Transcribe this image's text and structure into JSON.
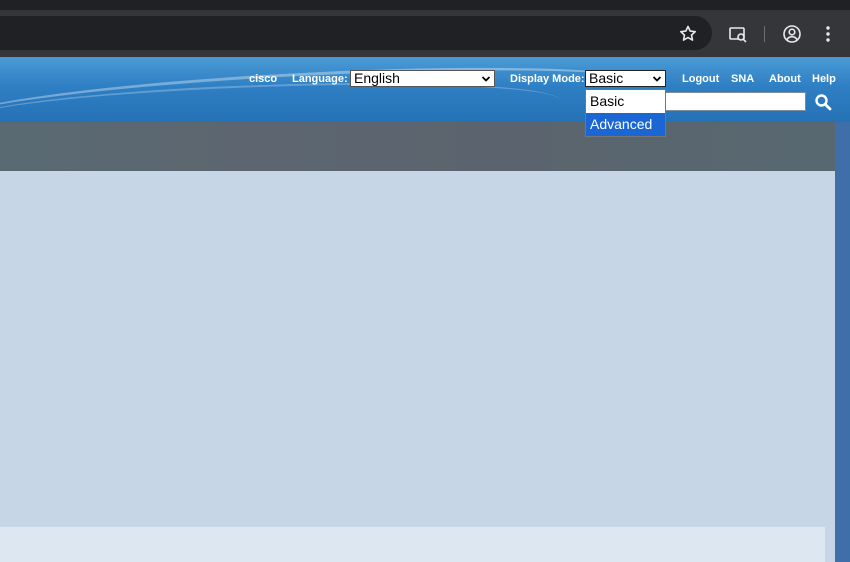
{
  "header": {
    "brand": "cisco",
    "language_label": "Language:",
    "language_value": "English",
    "display_mode_label": "Display Mode:",
    "display_mode_value": "Basic",
    "links": {
      "logout": "Logout",
      "sna": "SNA",
      "about": "About",
      "help": "Help"
    }
  },
  "display_mode_dropdown": {
    "options": [
      "Basic",
      "Advanced"
    ],
    "highlighted": "Advanced"
  },
  "icons": {
    "bookmark": "star-icon",
    "search_tabs": "tab-search-icon",
    "profile": "profile-icon",
    "menu": "kebab-menu-icon",
    "search": "search-icon",
    "chevron": "chevron-down-icon"
  },
  "colors": {
    "banner": "#2f7fc4",
    "navbar": "#5b646e",
    "content": "#c6d6e7",
    "highlight": "#1a66d2"
  }
}
